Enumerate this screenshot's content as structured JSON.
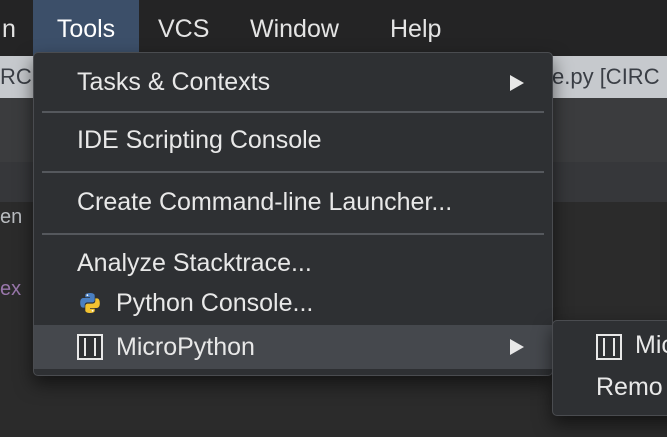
{
  "menubar": {
    "items": [
      {
        "label": "n"
      },
      {
        "label": "Tools"
      },
      {
        "label": "VCS"
      },
      {
        "label": "Window"
      },
      {
        "label": "Help"
      }
    ],
    "active_color": "#3c4f69"
  },
  "background": {
    "tab_left": "RC",
    "tab_right": "e.py [CIRC",
    "editor_text_1": "en",
    "editor_text_2": "ex"
  },
  "tools_menu": {
    "items": [
      {
        "label": "Tasks & Contexts",
        "submenu": true,
        "icon": "chevron-right-icon"
      },
      {
        "label": "IDE Scripting Console"
      },
      {
        "label": "Create Command-line Launcher..."
      },
      {
        "label": "Analyze Stacktrace..."
      },
      {
        "label": "Python Console...",
        "icon": "python-icon"
      },
      {
        "label": "MicroPython",
        "submenu": true,
        "icon": "micropython-icon",
        "highlighted": true
      }
    ]
  },
  "micropython_submenu": {
    "items": [
      {
        "label": "Mic",
        "icon": "micropython-icon"
      },
      {
        "label": "Remo"
      }
    ]
  }
}
